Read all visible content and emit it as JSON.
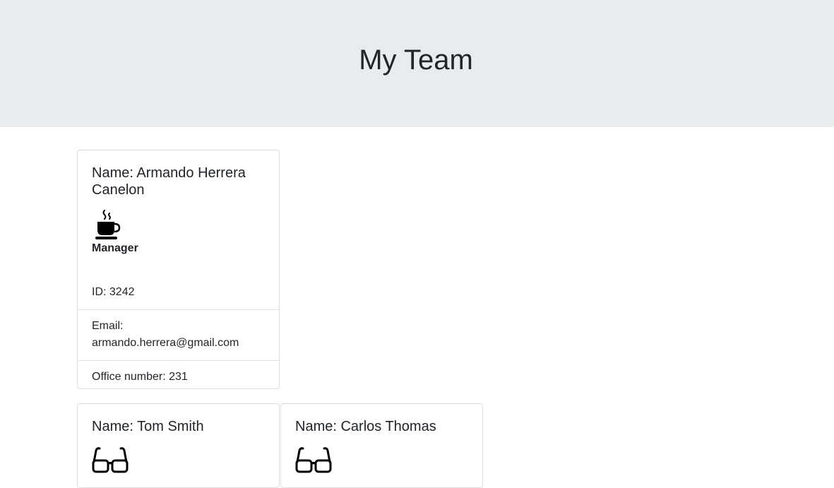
{
  "header": {
    "title": "My Team"
  },
  "team": [
    {
      "name": "Name: Armando Herrera Canelon",
      "role": "Manager",
      "icon": "coffee-cup-icon",
      "id": "ID: 3242",
      "email": "Email: armando.herrera@gmail.com",
      "extra": "Office number: 231"
    },
    {
      "name": "Name: Tom Smith",
      "icon": "glasses-icon"
    },
    {
      "name": "Name: Carlos Thomas",
      "icon": "glasses-icon"
    }
  ],
  "colors": {
    "header_bg": "#e9ecef",
    "text": "#212529",
    "card_border": "#dfdfdf"
  }
}
